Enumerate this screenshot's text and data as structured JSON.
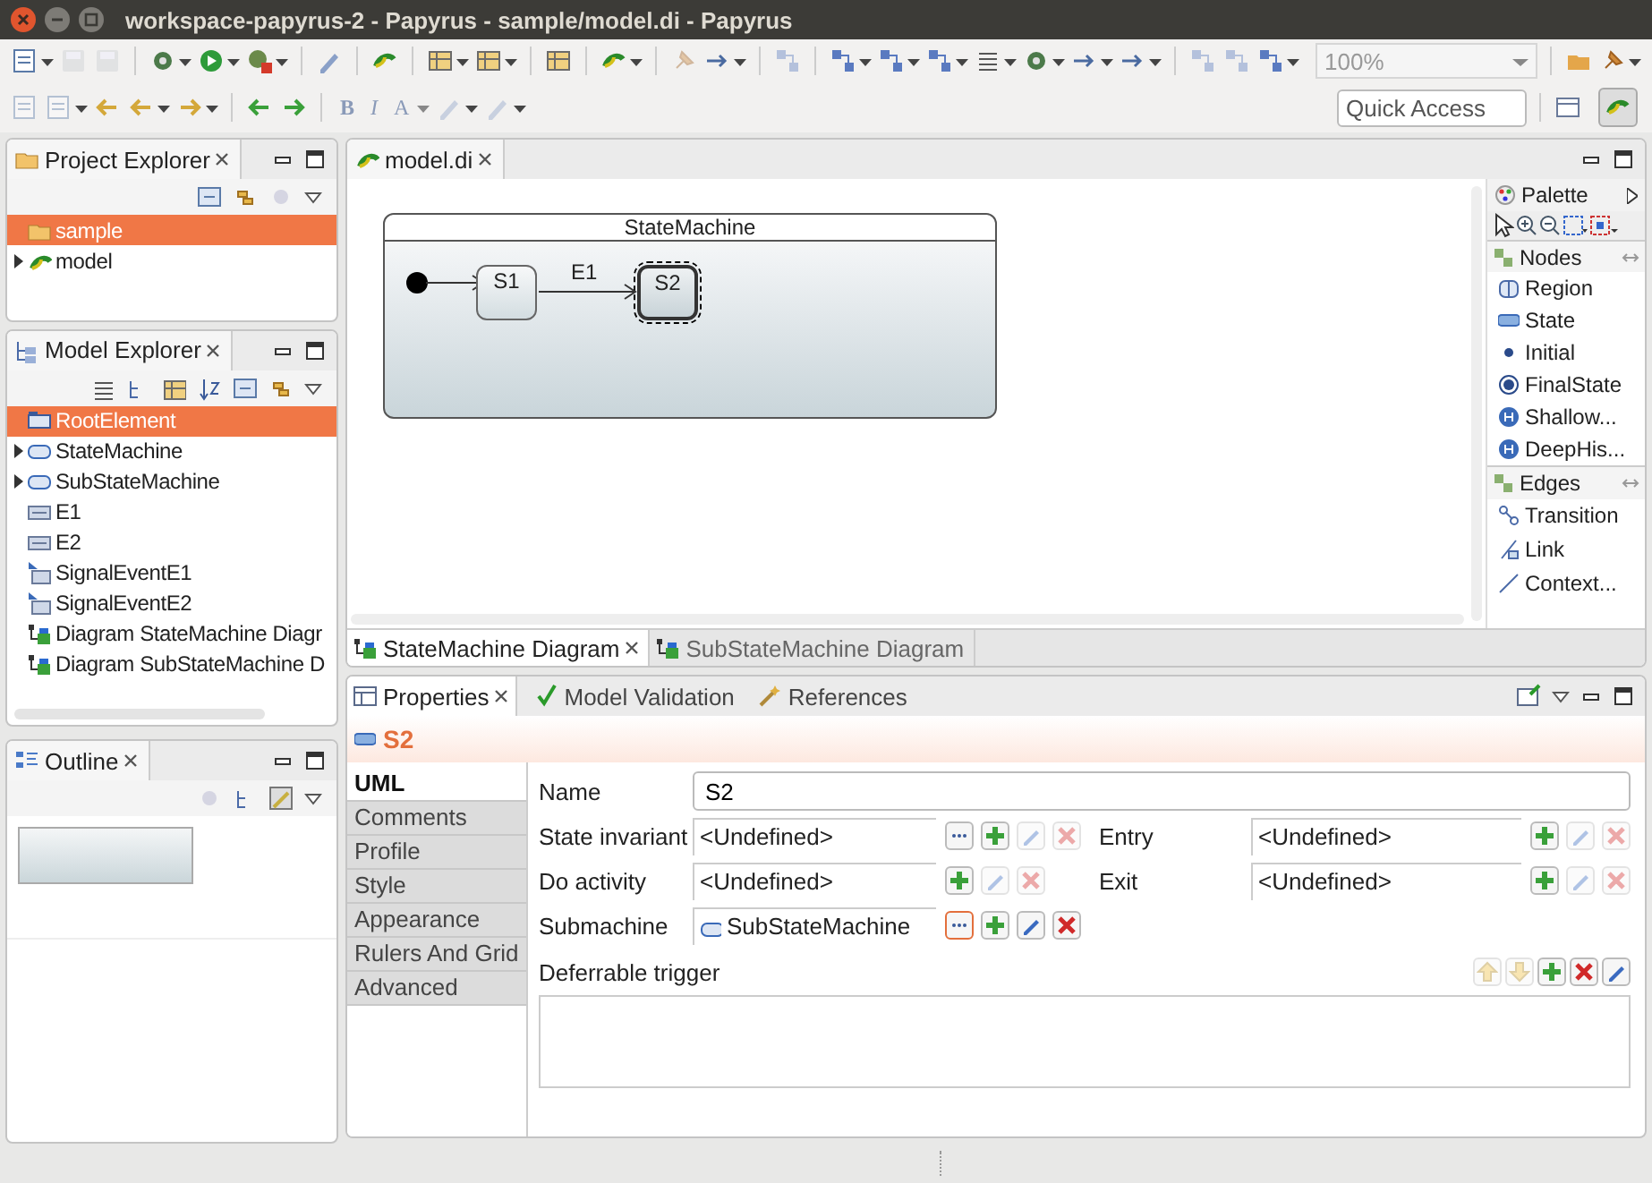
{
  "window": {
    "title": "workspace-papyrus-2 - Papyrus - sample/model.di - Papyrus"
  },
  "toolbar": {
    "zoom": "100%",
    "format_buttons": [
      {
        "label": "B",
        "kind": "bold"
      },
      {
        "label": "I",
        "kind": "italic"
      },
      {
        "label": "A",
        "kind": "plain"
      }
    ],
    "quick_access": {
      "placeholder": "Quick Access"
    }
  },
  "project_explorer": {
    "title": "Project Explorer",
    "items": [
      {
        "label": "sample",
        "kind": "folder",
        "selected": true,
        "collapsed": false
      },
      {
        "label": "model",
        "kind": "model",
        "selected": false,
        "collapsed": true
      }
    ]
  },
  "model_explorer": {
    "title": "Model Explorer",
    "items": [
      {
        "label": "RootElement",
        "kind": "package",
        "selected": true,
        "collapsed": false
      },
      {
        "label": "StateMachine",
        "kind": "statemachine",
        "selected": false,
        "collapsed": true
      },
      {
        "label": "SubStateMachine",
        "kind": "statemachine",
        "selected": false,
        "collapsed": true
      },
      {
        "label": "E1",
        "kind": "event",
        "selected": false,
        "collapsed": false
      },
      {
        "label": "E2",
        "kind": "event",
        "selected": false,
        "collapsed": false
      },
      {
        "label": "SignalEventE1",
        "kind": "signal-event",
        "selected": false,
        "collapsed": false
      },
      {
        "label": "SignalEventE2",
        "kind": "signal-event",
        "selected": false,
        "collapsed": false
      },
      {
        "label": "Diagram StateMachine Diagr",
        "kind": "diagram",
        "selected": false,
        "collapsed": false
      },
      {
        "label": "Diagram SubStateMachine D",
        "kind": "diagram",
        "selected": false,
        "collapsed": false
      }
    ]
  },
  "outline": {
    "title": "Outline"
  },
  "editor": {
    "tab": "model.di",
    "diagram": {
      "title": "StateMachine",
      "states": [
        {
          "label": "S1",
          "selected": false
        },
        {
          "label": "S2",
          "selected": true
        }
      ],
      "transitions": [
        {
          "label": "E1"
        }
      ]
    },
    "palette": {
      "title": "Palette",
      "groups": [
        {
          "title": "Nodes",
          "items": [
            {
              "label": "Region",
              "kind": "region"
            },
            {
              "label": "State",
              "kind": "state"
            },
            {
              "label": "Initial",
              "kind": "initial"
            },
            {
              "label": "FinalState",
              "kind": "final"
            },
            {
              "label": "Shallow...",
              "kind": "history"
            },
            {
              "label": "DeepHis...",
              "kind": "history"
            }
          ]
        },
        {
          "title": "Edges",
          "items": [
            {
              "label": "Transition",
              "kind": "transition"
            },
            {
              "label": "Link",
              "kind": "link"
            },
            {
              "label": "Context...",
              "kind": "context"
            }
          ]
        }
      ]
    },
    "diagram_tabs": [
      {
        "label": "StateMachine Diagram",
        "selected": true
      },
      {
        "label": "SubStateMachine Diagram",
        "selected": false
      }
    ]
  },
  "properties": {
    "tabs": [
      {
        "label": "Properties",
        "kind": "properties",
        "selected": true
      },
      {
        "label": "Model Validation",
        "kind": "validation",
        "selected": false
      },
      {
        "label": "References",
        "kind": "references",
        "selected": false
      }
    ],
    "element": "S2",
    "sections": [
      {
        "label": "UML",
        "selected": true
      },
      {
        "label": "Comments",
        "selected": false
      },
      {
        "label": "Profile",
        "selected": false
      },
      {
        "label": "Style",
        "selected": false
      },
      {
        "label": "Appearance",
        "selected": false
      },
      {
        "label": "Rulers And Grid",
        "selected": false
      },
      {
        "label": "Advanced",
        "selected": false
      }
    ],
    "name": {
      "label": "Name",
      "value": "S2"
    },
    "fields": [
      {
        "label": "State invariant",
        "value": "<Undefined>",
        "buttons": [
          {
            "kind": "browse",
            "disabled": false
          },
          {
            "kind": "add",
            "disabled": false
          },
          {
            "kind": "edit",
            "disabled": true
          },
          {
            "kind": "delete",
            "disabled": true
          }
        ]
      },
      {
        "label": "Entry",
        "value": "<Undefined>",
        "buttons": [
          {
            "kind": "add",
            "disabled": false
          },
          {
            "kind": "edit",
            "disabled": true
          },
          {
            "kind": "delete",
            "disabled": true
          }
        ]
      },
      {
        "label": "Do activity",
        "value": "<Undefined>",
        "buttons": [
          {
            "kind": "add",
            "disabled": false
          },
          {
            "kind": "edit",
            "disabled": true
          },
          {
            "kind": "delete",
            "disabled": true
          }
        ]
      },
      {
        "label": "Exit",
        "value": "<Undefined>",
        "buttons": [
          {
            "kind": "add",
            "disabled": false
          },
          {
            "kind": "edit",
            "disabled": true
          },
          {
            "kind": "delete",
            "disabled": true
          }
        ]
      },
      {
        "label": "Submachine",
        "value": "SubStateMachine",
        "buttons": [
          {
            "kind": "browse",
            "disabled": false
          },
          {
            "kind": "add",
            "disabled": false
          },
          {
            "kind": "edit",
            "disabled": false
          },
          {
            "kind": "delete",
            "disabled": false
          }
        ]
      }
    ],
    "list": {
      "label": "Deferrable trigger",
      "buttons": [
        {
          "kind": "up",
          "disabled": true
        },
        {
          "kind": "down",
          "disabled": true
        },
        {
          "kind": "add",
          "disabled": false
        },
        {
          "kind": "delete",
          "disabled": false
        },
        {
          "kind": "edit",
          "disabled": false
        }
      ]
    }
  }
}
